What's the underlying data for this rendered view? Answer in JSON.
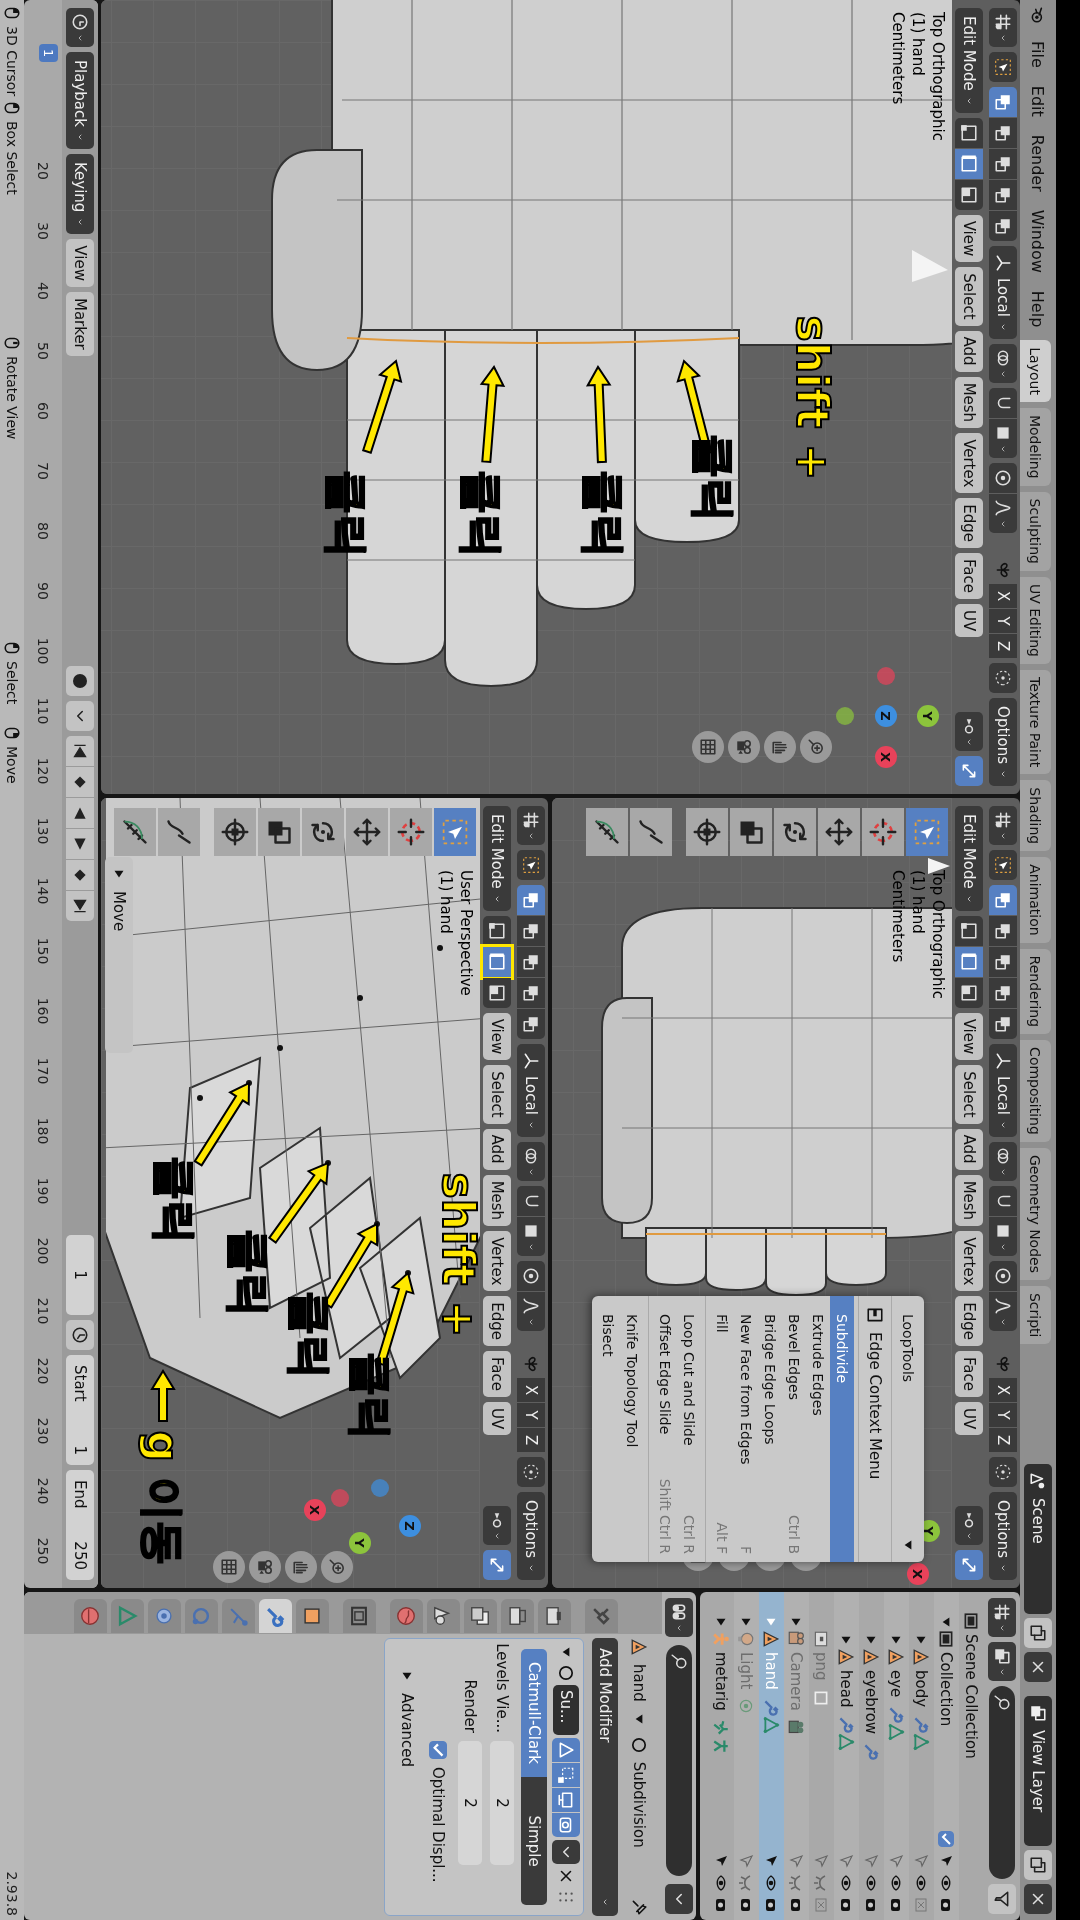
{
  "topbar": {
    "menus": [
      "File",
      "Edit",
      "Render",
      "Window",
      "Help"
    ],
    "workspaces": [
      {
        "label": "Layout",
        "selected": true
      },
      {
        "label": "Modeling",
        "selected": false
      },
      {
        "label": "Sculpting",
        "selected": false
      },
      {
        "label": "UV Editing",
        "selected": false
      },
      {
        "label": "Texture Paint",
        "selected": false
      },
      {
        "label": "Shading",
        "selected": false
      },
      {
        "label": "Animation",
        "selected": false
      },
      {
        "label": "Rendering",
        "selected": false
      },
      {
        "label": "Compositing",
        "selected": false
      },
      {
        "label": "Geometry Nodes",
        "selected": false
      },
      {
        "label": "Scripti",
        "selected": false
      }
    ],
    "scene": "Scene",
    "view_layer": "View Layer"
  },
  "viewports": [
    {
      "kind": "top-close",
      "mode": "Edit Mode",
      "menus": [
        "View",
        "Select",
        "Add",
        "Mesh",
        "Vertex",
        "Edge",
        "Face",
        "UV"
      ],
      "pivot": "Local",
      "axes": [
        "X",
        "Y",
        "Z"
      ],
      "options": "Options",
      "select_modes": [
        {
          "kind": "vertex",
          "selected": false,
          "outlined": false
        },
        {
          "kind": "edge",
          "selected": true,
          "outlined": false
        },
        {
          "kind": "face",
          "selected": false,
          "outlined": false
        }
      ],
      "overlay": [
        "Top Orthographic",
        "(1) hand",
        "Centimeters"
      ],
      "gizmo": [
        {
          "label": "Y",
          "color": "#8cc43c"
        },
        {
          "label": "Z",
          "color": "#3d8fe0"
        },
        {
          "label": "X",
          "color": "#e8425a"
        }
      ],
      "annotations": [
        {
          "kind": "text",
          "text": "shift +"
        },
        {
          "kind": "arrow",
          "text": "클릭"
        },
        {
          "kind": "arrow",
          "text": "클릭"
        },
        {
          "kind": "arrow",
          "text": "클릭"
        },
        {
          "kind": "arrow",
          "text": "클릭"
        }
      ]
    },
    {
      "kind": "top",
      "mode": "Edit Mode",
      "menus": [
        "View",
        "Select",
        "Add",
        "Mesh",
        "Vertex",
        "Edge",
        "Face",
        "UV"
      ],
      "pivot": "Local",
      "axes": [
        "X",
        "Y",
        "Z"
      ],
      "options": "Options",
      "select_modes": [
        {
          "kind": "vertex",
          "selected": false,
          "outlined": false
        },
        {
          "kind": "edge",
          "selected": true,
          "outlined": false
        },
        {
          "kind": "face",
          "selected": false,
          "outlined": false
        }
      ],
      "overlay": [
        "Top Orthographic",
        "(1) hand",
        "Centimeters"
      ],
      "tools": [
        {
          "kind": "select-box",
          "selected": true
        },
        {
          "kind": "cursor",
          "selected": false
        },
        {
          "kind": "move",
          "selected": false
        },
        {
          "kind": "rotate",
          "selected": false
        },
        {
          "kind": "scale",
          "selected": false
        },
        {
          "kind": "transform",
          "selected": false
        },
        {
          "kind": "annotate",
          "selected": false
        },
        {
          "kind": "measure",
          "selected": false
        }
      ],
      "gizmo": [
        {
          "label": "Y",
          "color": "#8cc43c"
        },
        {
          "label": "X",
          "color": "#e8425a"
        }
      ],
      "context_menu": {
        "items": [
          {
            "kind": "submenu",
            "label": "LoopTools",
            "selected": false
          },
          {
            "kind": "separator"
          },
          {
            "kind": "title",
            "label": "Edge Context Menu"
          },
          {
            "kind": "separator"
          },
          {
            "kind": "item",
            "label": "Subdivide",
            "selected": true
          },
          {
            "kind": "item",
            "label": "Extrude Edges",
            "selected": false
          },
          {
            "kind": "item",
            "label": "Bevel Edges",
            "shortcut": "Ctrl B",
            "selected": false
          },
          {
            "kind": "item",
            "label": "Bridge Edge Loops",
            "selected": false
          },
          {
            "kind": "item",
            "label": "New Face from Edges",
            "shortcut": "F",
            "selected": false
          },
          {
            "kind": "item",
            "label": "Fill",
            "shortcut": "Alt F",
            "selected": false
          },
          {
            "kind": "separator"
          },
          {
            "kind": "item",
            "label": "Loop Cut and Slide",
            "shortcut": "Ctrl R",
            "selected": false
          },
          {
            "kind": "item",
            "label": "Offset Edge Slide",
            "shortcut": "Shift Ctrl R",
            "selected": false
          },
          {
            "kind": "separator"
          },
          {
            "kind": "item",
            "label": "Knife Topology Tool",
            "selected": false
          },
          {
            "kind": "item",
            "label": "Bisect",
            "selected": false
          }
        ]
      }
    },
    {
      "kind": "perspective",
      "mode": "Edit Mode",
      "menus": [
        "View",
        "Select",
        "Add",
        "Mesh",
        "Vertex",
        "Edge",
        "Face",
        "UV"
      ],
      "pivot": "Local",
      "axes": [
        "X",
        "Y",
        "Z"
      ],
      "options": "Options",
      "select_modes": [
        {
          "kind": "vertex",
          "selected": false,
          "outlined": false
        },
        {
          "kind": "edge",
          "selected": true,
          "outlined": true
        },
        {
          "kind": "face",
          "selected": false,
          "outlined": false
        }
      ],
      "overlay": [
        "User Perspective",
        "(1) hand"
      ],
      "tools": [
        {
          "kind": "select-box",
          "selected": true
        },
        {
          "kind": "cursor",
          "selected": false
        },
        {
          "kind": "move",
          "selected": false
        },
        {
          "kind": "rotate",
          "selected": false
        },
        {
          "kind": "scale",
          "selected": false
        },
        {
          "kind": "transform",
          "selected": false
        },
        {
          "kind": "annotate",
          "selected": false
        },
        {
          "kind": "measure",
          "selected": false
        }
      ],
      "gizmo": [
        {
          "label": "Z",
          "color": "#3d8fe0"
        },
        {
          "label": "Y",
          "color": "#8cc43c"
        },
        {
          "label": "X",
          "color": "#e8425a"
        }
      ],
      "operator_panel": {
        "label": "Move",
        "expanded": false
      },
      "annotations": [
        {
          "kind": "text",
          "text": "shift +"
        },
        {
          "kind": "arrow",
          "text": "클릭"
        },
        {
          "kind": "arrow",
          "text": "클릭"
        },
        {
          "kind": "arrow",
          "text": "클릭"
        },
        {
          "kind": "arrow",
          "text": "클릭"
        },
        {
          "kind": "arrow",
          "text": "g 이동"
        }
      ]
    }
  ],
  "timeline": {
    "menus": [
      "Playback",
      "Keying",
      "View",
      "Marker"
    ],
    "auto_key": false,
    "frame": "1",
    "start_label": "Start",
    "start": "1",
    "end_label": "End",
    "end": "250",
    "playhead": "1",
    "ruler": [
      "20",
      "30",
      "40",
      "50",
      "60",
      "70",
      "80",
      "90",
      "100",
      "110",
      "120",
      "130",
      "140",
      "150",
      "160",
      "170",
      "180",
      "190",
      "200",
      "210",
      "220",
      "230",
      "240",
      "250"
    ]
  },
  "outliner": {
    "rows": [
      {
        "kind": "scene-collection",
        "name": "Scene Collection",
        "children": [
          {
            "kind": "collection",
            "name": "Collection",
            "expanded": true,
            "included": true,
            "selected": false,
            "selectable": true,
            "visible": true,
            "renderable": true,
            "children": [
              {
                "kind": "mesh",
                "name": "body",
                "expanded": false,
                "selected": false,
                "selectable": false,
                "visible": true,
                "renderable": false,
                "data_icons": [
                  {
                    "kind": "modifier"
                  },
                  {
                    "kind": "mesh"
                  }
                ]
              },
              {
                "kind": "mesh",
                "name": "eye",
                "expanded": false,
                "selected": false,
                "selectable": false,
                "visible": true,
                "renderable": true,
                "data_icons": [
                  {
                    "kind": "modifier"
                  },
                  {
                    "kind": "mesh"
                  }
                ]
              },
              {
                "kind": "mesh",
                "name": "eyebrow",
                "expanded": false,
                "selected": false,
                "selectable": false,
                "visible": true,
                "renderable": true,
                "data_icons": [
                  {
                    "kind": "modifier"
                  }
                ]
              },
              {
                "kind": "mesh",
                "name": "head",
                "expanded": false,
                "selected": false,
                "selectable": false,
                "visible": true,
                "renderable": true,
                "data_icons": [
                  {
                    "kind": "modifier"
                  },
                  {
                    "kind": "mesh"
                  }
                ]
              }
            ]
          },
          {
            "kind": "image",
            "name": "png",
            "selected": false,
            "selectable": false,
            "visible": false,
            "renderable": false,
            "data_icons": [
              {
                "kind": "empty"
              }
            ]
          },
          {
            "kind": "camera",
            "name": "Camera",
            "expanded": false,
            "selected": false,
            "selectable": false,
            "visible": false,
            "renderable": true,
            "data_icons": [
              {
                "kind": "camera"
              }
            ]
          },
          {
            "kind": "mesh",
            "name": "hand",
            "expanded": false,
            "selected": true,
            "selectable": true,
            "visible": true,
            "renderable": true,
            "data_icons": [
              {
                "kind": "modifier"
              },
              {
                "kind": "mesh"
              }
            ]
          },
          {
            "kind": "light",
            "name": "Light",
            "expanded": false,
            "selected": false,
            "selectable": false,
            "visible": false,
            "renderable": true,
            "data_icons": [
              {
                "kind": "light"
              }
            ]
          },
          {
            "kind": "armature",
            "name": "metarig",
            "expanded": false,
            "selected": false,
            "selectable": true,
            "visible": true,
            "renderable": true,
            "data_icons": [
              {
                "kind": "pose"
              },
              {
                "kind": "armature"
              }
            ]
          }
        ]
      }
    ]
  },
  "properties": {
    "tabs": [
      {
        "kind": "tool",
        "selected": false
      },
      {
        "kind": "render",
        "selected": false
      },
      {
        "kind": "output",
        "selected": false
      },
      {
        "kind": "view-layer",
        "selected": false
      },
      {
        "kind": "scene",
        "selected": false
      },
      {
        "kind": "world",
        "selected": false
      },
      {
        "kind": "collection",
        "selected": false
      },
      {
        "kind": "object",
        "selected": false
      },
      {
        "kind": "modifier",
        "selected": true
      },
      {
        "kind": "particles",
        "selected": false
      },
      {
        "kind": "physics",
        "selected": false
      },
      {
        "kind": "constraints",
        "selected": false
      },
      {
        "kind": "data",
        "selected": false
      },
      {
        "kind": "material",
        "selected": false
      }
    ],
    "object": "hand",
    "modifier_name": "Subdivision",
    "add_modifier": "Add Modifier",
    "modifier": {
      "name": "Su...",
      "expanded": true,
      "show_in_editmode": true,
      "show_on_cage": true,
      "show_viewport": true,
      "show_render": true,
      "types": [
        {
          "label": "Catmull-Clark",
          "selected": true
        },
        {
          "label": "Simple",
          "selected": false
        }
      ],
      "fields": [
        {
          "label": "Levels Vie...",
          "value": "2"
        },
        {
          "label": "Render",
          "value": "2"
        }
      ],
      "optimal": {
        "label": "Optimal Displ...",
        "checked": true
      },
      "advanced": {
        "label": "Advanced",
        "expanded": false
      }
    }
  },
  "status_bar": {
    "hints": [
      {
        "kind": "left-click",
        "text": "3D Cursor"
      },
      {
        "kind": "left-drag",
        "text": "Box Select"
      },
      {
        "kind": "middle-drag",
        "text": "Rotate View"
      },
      {
        "kind": "left-click",
        "text": "Select"
      },
      {
        "kind": "right-drag",
        "text": "Move"
      }
    ],
    "version": "2.93.8"
  }
}
